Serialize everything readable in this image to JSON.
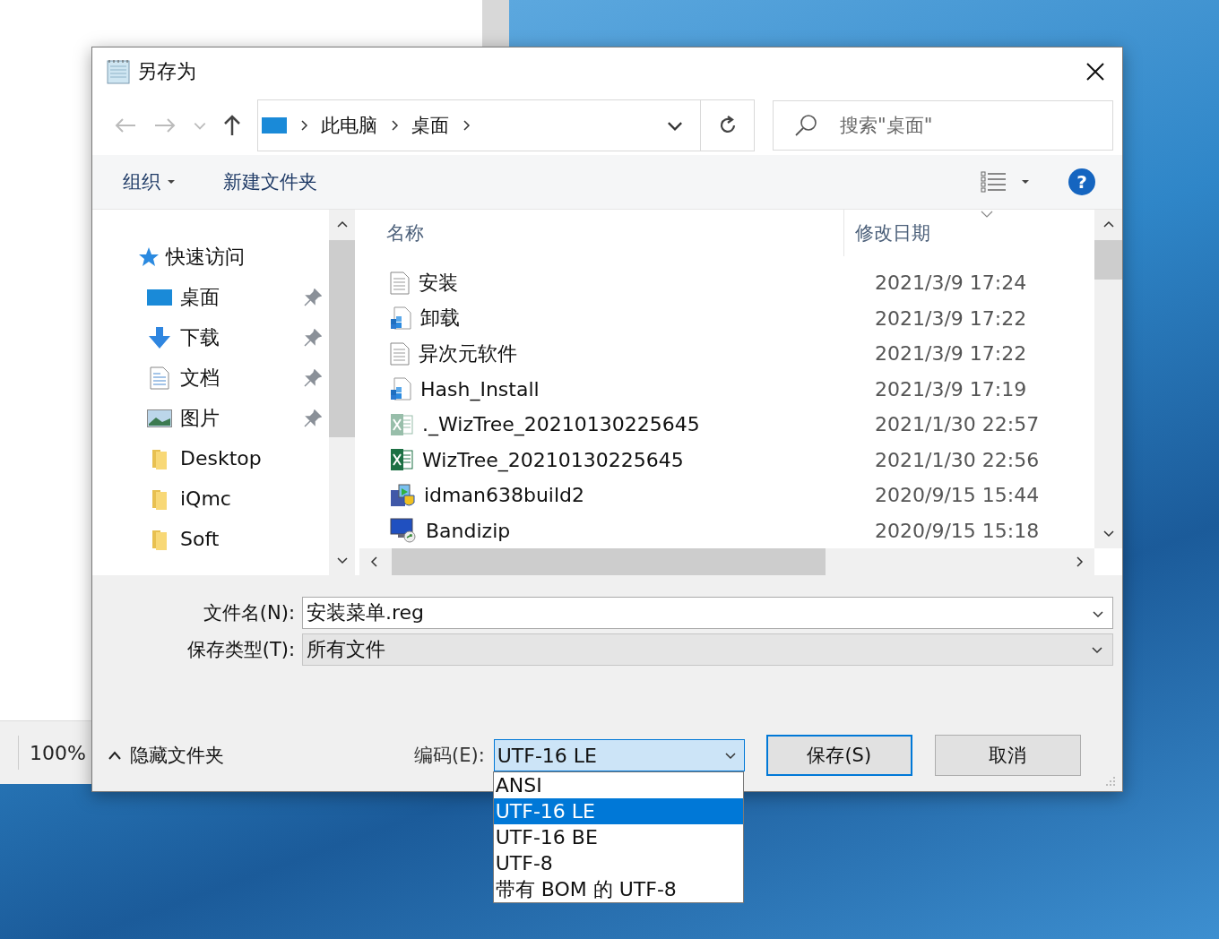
{
  "background_window": {
    "zoom": "100%"
  },
  "dialog": {
    "title": "另存为",
    "address": {
      "breadcrumb": [
        "此电脑",
        "桌面"
      ],
      "search_placeholder": "搜索\"桌面\""
    },
    "toolbar": {
      "organize": "组织",
      "new_folder": "新建文件夹",
      "help": "?"
    },
    "sidebar": [
      {
        "label": "快速访问",
        "kind": "quick-access",
        "children": [
          {
            "label": "桌面",
            "kind": "desktop",
            "pinned": true
          },
          {
            "label": "下载",
            "kind": "download",
            "pinned": true
          },
          {
            "label": "文档",
            "kind": "document",
            "pinned": true
          },
          {
            "label": "图片",
            "kind": "picture",
            "pinned": true
          },
          {
            "label": "Desktop",
            "kind": "folder",
            "pinned": false
          },
          {
            "label": "iQmc",
            "kind": "folder",
            "pinned": false
          },
          {
            "label": "Soft",
            "kind": "folder",
            "pinned": false
          }
        ]
      }
    ],
    "columns": [
      "名称",
      "修改日期"
    ],
    "files": [
      {
        "name": "安装",
        "date": "2021/3/9 17:24",
        "kind": "text"
      },
      {
        "name": "卸载",
        "date": "2021/3/9 17:22",
        "kind": "registry"
      },
      {
        "name": "异次元软件",
        "date": "2021/3/9 17:22",
        "kind": "text"
      },
      {
        "name": "Hash_Install",
        "date": "2021/3/9 17:19",
        "kind": "registry"
      },
      {
        "name": "._WizTree_20210130225645",
        "date": "2021/1/30 22:57",
        "kind": "spreadsheet-hidden"
      },
      {
        "name": "WizTree_20210130225645",
        "date": "2021/1/30 22:56",
        "kind": "spreadsheet"
      },
      {
        "name": "idman638build2",
        "date": "2020/9/15 15:44",
        "kind": "installer"
      },
      {
        "name": "Bandizip",
        "date": "2020/9/15 15:18",
        "kind": "shortcut"
      }
    ],
    "file_name": {
      "label": "文件名(N):",
      "value": "安装菜单.reg"
    },
    "save_type": {
      "label": "保存类型(T):",
      "value": "所有文件"
    },
    "hide_folders": "隐藏文件夹",
    "encoding": {
      "label": "编码(E):",
      "value": "UTF-16 LE",
      "expanded": true,
      "options": [
        {
          "label": "ANSI",
          "selected": false
        },
        {
          "label": "UTF-16 LE",
          "selected": true
        },
        {
          "label": "UTF-16 BE",
          "selected": false
        },
        {
          "label": "UTF-8",
          "selected": false
        },
        {
          "label": "带有 BOM 的 UTF-8",
          "selected": false
        }
      ]
    },
    "buttons": [
      {
        "label": "保存(S)",
        "default": true
      },
      {
        "label": "取消",
        "default": false
      }
    ]
  }
}
